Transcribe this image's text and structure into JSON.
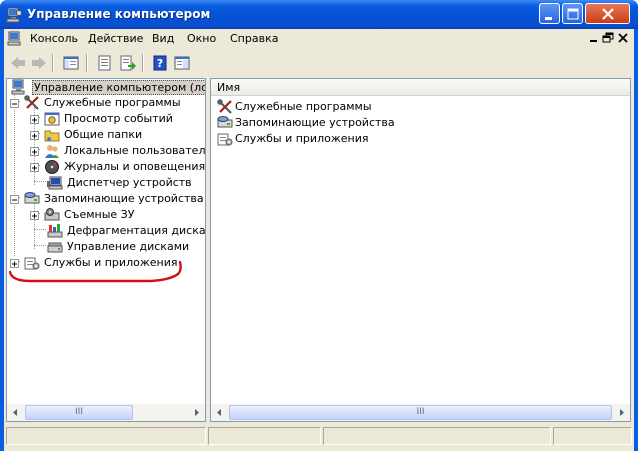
{
  "window": {
    "title": "Управление компьютером"
  },
  "menubar": {
    "items": [
      "Консоль",
      "Действие",
      "Вид",
      "Окно",
      "Справка"
    ]
  },
  "tree": {
    "root": "Управление компьютером (локальн",
    "nodes": [
      {
        "label": "Служебные программы",
        "icon": "tools-icon"
      },
      {
        "label": "Просмотр событий",
        "icon": "event-viewer-icon"
      },
      {
        "label": "Общие папки",
        "icon": "shared-folders-icon"
      },
      {
        "label": "Локальные пользователи",
        "icon": "local-users-icon"
      },
      {
        "label": "Журналы и оповещения пр",
        "icon": "performance-logs-icon"
      },
      {
        "label": "Диспетчер устройств",
        "icon": "device-manager-icon"
      },
      {
        "label": "Запоминающие устройства",
        "icon": "storage-icon"
      },
      {
        "label": "Съемные ЗУ",
        "icon": "removable-storage-icon"
      },
      {
        "label": "Дефрагментация диска",
        "icon": "defrag-icon"
      },
      {
        "label": "Управление дисками",
        "icon": "disk-management-icon"
      },
      {
        "label": "Службы и приложения",
        "icon": "services-apps-icon"
      }
    ]
  },
  "list": {
    "column_name": "Имя",
    "items": [
      {
        "label": "Служебные программы",
        "icon": "tools-icon"
      },
      {
        "label": "Запоминающие устройства",
        "icon": "storage-icon"
      },
      {
        "label": "Службы и приложения",
        "icon": "services-apps-icon"
      }
    ]
  },
  "scrollbar": {
    "grip": "III"
  },
  "colors": {
    "titlebar": "#0a5ce0",
    "chrome": "#ece9d8",
    "annotation": "#d0101a"
  }
}
